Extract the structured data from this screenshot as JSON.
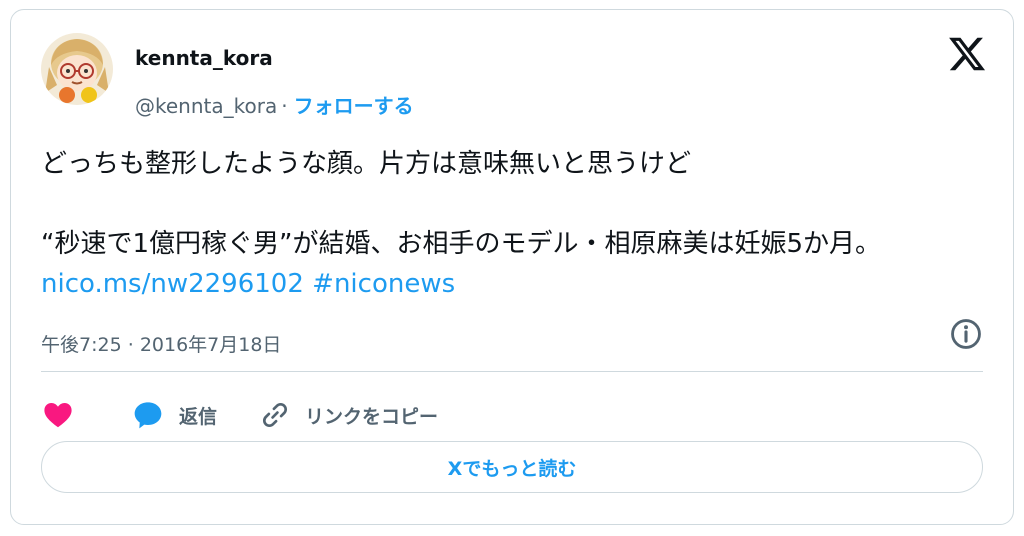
{
  "author": {
    "display_name": "kennta_kora",
    "handle": "@kennta_kora",
    "separator": "·",
    "follow_label": "フォローする"
  },
  "tweet": {
    "line1": "どっちも整形したような顔。片方は意味無いと思うけど",
    "line2": "“秒速で1億円稼ぐ男”が結婚、お相手のモデル・相原麻美は妊娠5か月。",
    "link": "nico.ms/nw2296102",
    "hashtag": "#niconews"
  },
  "meta": {
    "time": "午後7:25",
    "separator": "·",
    "date": "2016年7月18日"
  },
  "actions": {
    "reply_label": "返信",
    "copy_link_label": "リンクをコピー"
  },
  "read_more_label": "Xでもっと読む",
  "icons": {
    "logo": "x-logo-icon",
    "like": "heart-icon",
    "reply": "speech-bubble-icon",
    "copy": "link-icon",
    "info": "info-icon"
  },
  "colors": {
    "accent": "#1d9bf0",
    "like": "#f91880",
    "muted": "#536471",
    "text": "#0f1419",
    "border": "#cfd9de"
  }
}
